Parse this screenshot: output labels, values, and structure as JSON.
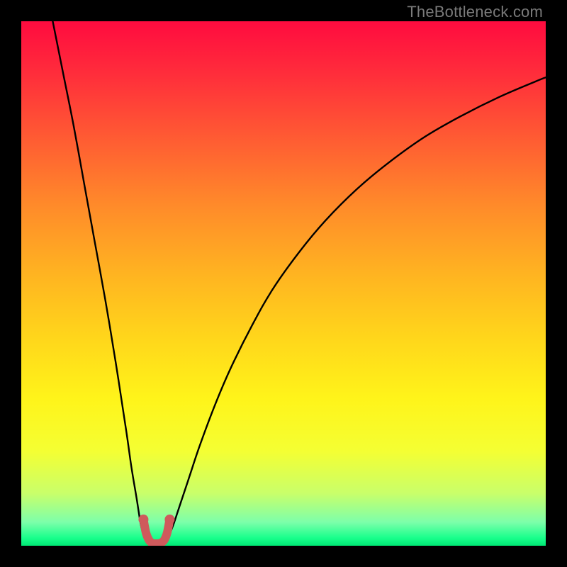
{
  "watermark": "TheBottleneck.com",
  "chart_data": {
    "type": "line",
    "title": "",
    "xlabel": "",
    "ylabel": "",
    "xlim": [
      0,
      100
    ],
    "ylim": [
      0,
      100
    ],
    "series": [
      {
        "name": "curve-left",
        "x": [
          6,
          8,
          10,
          12,
          14,
          16,
          18,
          20,
          21,
          22,
          22.8,
          23.4,
          24
        ],
        "y": [
          100,
          90,
          80,
          69,
          58,
          47,
          35,
          22,
          15,
          9,
          4,
          2,
          0.5
        ]
      },
      {
        "name": "curve-right",
        "x": [
          27.5,
          28.2,
          29,
          30,
          32,
          34,
          37,
          40,
          44,
          48,
          53,
          58,
          64,
          70,
          77,
          84,
          91,
          98,
          100
        ],
        "y": [
          0.5,
          2,
          4,
          7,
          13,
          19,
          27,
          34,
          42,
          49,
          56,
          62,
          68,
          73,
          78,
          82,
          85.5,
          88.5,
          89.3
        ]
      },
      {
        "name": "marker-segment",
        "x": [
          23.3,
          23.8,
          24.4,
          25.0,
          25.8,
          26.5,
          27.2,
          27.8,
          28.3
        ],
        "y": [
          5.0,
          2.4,
          1.0,
          0.5,
          0.4,
          0.5,
          1.0,
          2.4,
          5.0
        ]
      }
    ],
    "background_gradient": {
      "stops": [
        {
          "offset": 0.0,
          "color": "#ff0b3f"
        },
        {
          "offset": 0.1,
          "color": "#ff2d3b"
        },
        {
          "offset": 0.22,
          "color": "#ff5a33"
        },
        {
          "offset": 0.35,
          "color": "#ff8a2a"
        },
        {
          "offset": 0.48,
          "color": "#ffb321"
        },
        {
          "offset": 0.6,
          "color": "#ffd51b"
        },
        {
          "offset": 0.72,
          "color": "#fff41a"
        },
        {
          "offset": 0.82,
          "color": "#f4ff33"
        },
        {
          "offset": 0.9,
          "color": "#c9ff6a"
        },
        {
          "offset": 0.955,
          "color": "#7dffaa"
        },
        {
          "offset": 0.985,
          "color": "#19ff8c"
        },
        {
          "offset": 1.0,
          "color": "#00e874"
        }
      ]
    },
    "marker_color": "#cf5a5c",
    "curve_color": "#000000"
  }
}
